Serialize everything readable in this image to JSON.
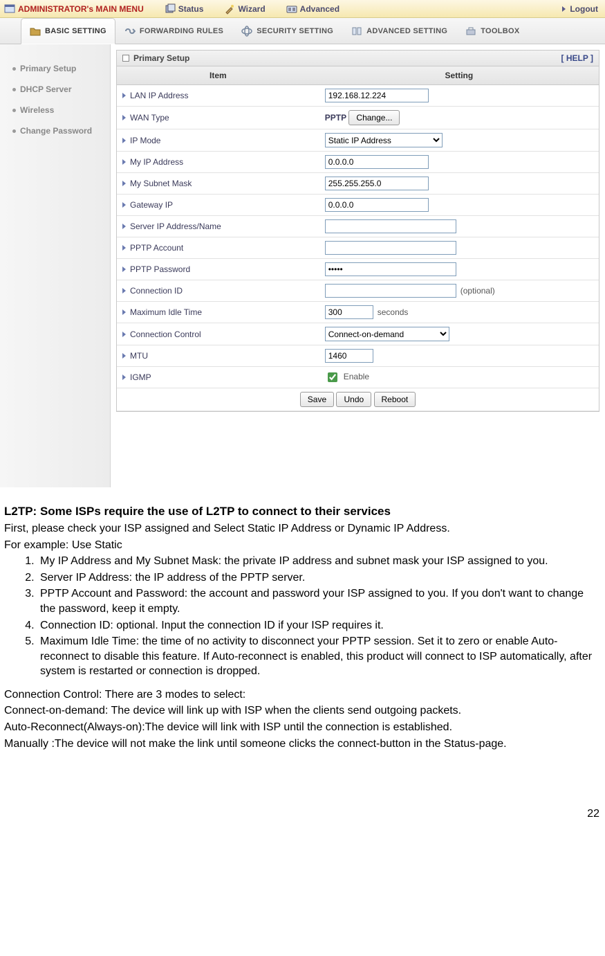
{
  "topmenu": {
    "admin": "ADMINISTRATOR's MAIN MENU",
    "status": "Status",
    "wizard": "Wizard",
    "advanced": "Advanced",
    "logout": "Logout"
  },
  "tabs": {
    "basic": "BASIC SETTING",
    "forwarding": "FORWARDING RULES",
    "security": "SECURITY SETTING",
    "advanced": "ADVANCED SETTING",
    "toolbox": "TOOLBOX"
  },
  "sidebar": {
    "items": [
      "Primary Setup",
      "DHCP Server",
      "Wireless",
      "Change Password"
    ]
  },
  "panel": {
    "title": "Primary Setup",
    "help": "[ HELP ]",
    "th_item": "Item",
    "th_setting": "Setting"
  },
  "rows": {
    "lan_ip": {
      "label": "LAN IP Address",
      "value": "192.168.12.224"
    },
    "wan_type": {
      "label": "WAN Type",
      "value": "PPTP",
      "btn": "Change..."
    },
    "ip_mode": {
      "label": "IP Mode",
      "value": "Static IP Address"
    },
    "my_ip": {
      "label": "My IP Address",
      "value": "0.0.0.0"
    },
    "subnet": {
      "label": "My Subnet Mask",
      "value": "255.255.255.0"
    },
    "gateway": {
      "label": "Gateway IP",
      "value": "0.0.0.0"
    },
    "server_ip": {
      "label": "Server IP Address/Name",
      "value": ""
    },
    "pptp_acct": {
      "label": "PPTP Account",
      "value": ""
    },
    "pptp_pass": {
      "label": "PPTP Password",
      "value": "•••••"
    },
    "conn_id": {
      "label": "Connection ID",
      "value": "",
      "note": "(optional)"
    },
    "max_idle": {
      "label": "Maximum Idle Time",
      "value": "300",
      "note": "seconds"
    },
    "conn_ctrl": {
      "label": "Connection Control",
      "value": "Connect-on-demand"
    },
    "mtu": {
      "label": "MTU",
      "value": "1460"
    },
    "igmp": {
      "label": "IGMP",
      "note": "Enable",
      "checked": true
    }
  },
  "buttons": {
    "save": "Save",
    "undo": "Undo",
    "reboot": "Reboot"
  },
  "doc": {
    "h": "L2TP: Some ISPs require the use of L2TP to connect to their services",
    "intro1": "First, please check your ISP assigned and Select Static IP Address or Dynamic IP Address.",
    "intro2": "For example: Use Static",
    "li1": "My IP Address and My Subnet Mask: the private IP address and subnet mask your ISP assigned to you.",
    "li2": "Server IP Address: the IP address of the PPTP server.",
    "li3": "PPTP Account and Password: the account and password your ISP assigned to you. If you don't want to change the password, keep it empty.",
    "li4": "Connection ID: optional. Input the connection ID if your ISP requires it.",
    "li5": "Maximum Idle Time: the time of no activity to disconnect your PPTP session. Set it to zero or enable Auto-reconnect to disable this feature. If Auto-reconnect is enabled, this product will connect to ISP automatically, after system is restarted or connection is dropped.",
    "cc_h": "Connection Control: There are 3 modes to select:",
    "cc1": "Connect-on-demand: The device will link up with ISP when the clients send outgoing packets.",
    "cc2": "Auto-Reconnect(Always-on):The device will link with ISP until the connection is established.",
    "cc3": "Manually :The device will not make the link until someone clicks the connect-button in the Status-page.",
    "pagenum": "22"
  }
}
